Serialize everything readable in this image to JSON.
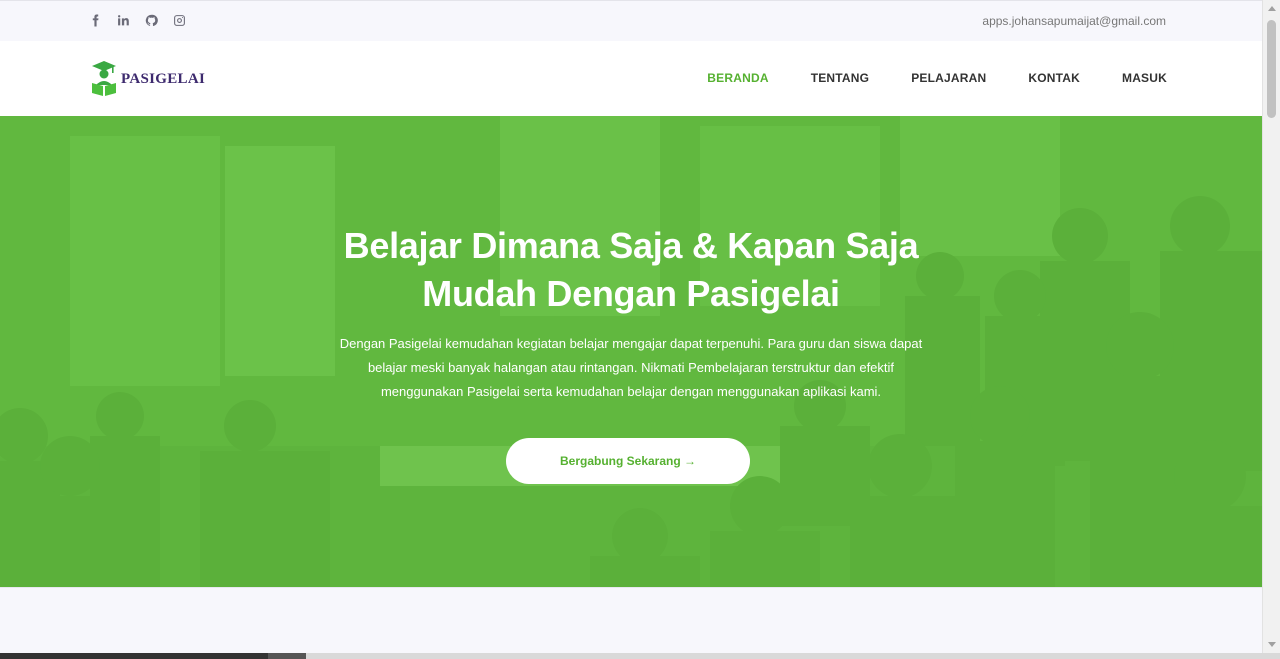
{
  "topbar": {
    "social_icons": [
      "facebook-icon",
      "linkedin-icon",
      "github-icon",
      "instagram-icon"
    ],
    "email": "apps.johansapumaijat@gmail.com"
  },
  "brand": {
    "name": "PASIGELAI",
    "color": "#3d2a6e",
    "accent": "#56b131"
  },
  "nav": {
    "items": [
      {
        "label": "BERANDA",
        "active": true
      },
      {
        "label": "TENTANG",
        "active": false
      },
      {
        "label": "PELAJARAN",
        "active": false
      },
      {
        "label": "KONTAK",
        "active": false
      },
      {
        "label": "MASUK",
        "active": false
      }
    ]
  },
  "hero": {
    "title_line1": "Belajar Dimana Saja & Kapan Saja",
    "title_line2": "Mudah Dengan Pasigelai",
    "description": "Dengan Pasigelai kemudahan kegiatan belajar mengajar dapat terpenuhi. Para guru dan siswa dapat belajar meski banyak halangan atau rintangan. Nikmati Pembelajaran terstruktur dan efektif menggunakan Pasigelai serta kemudahan belajar dengan menggunakan aplikasi kami.",
    "cta_label": "Bergabung Sekarang →",
    "overlay_color": "#62bd3e"
  }
}
